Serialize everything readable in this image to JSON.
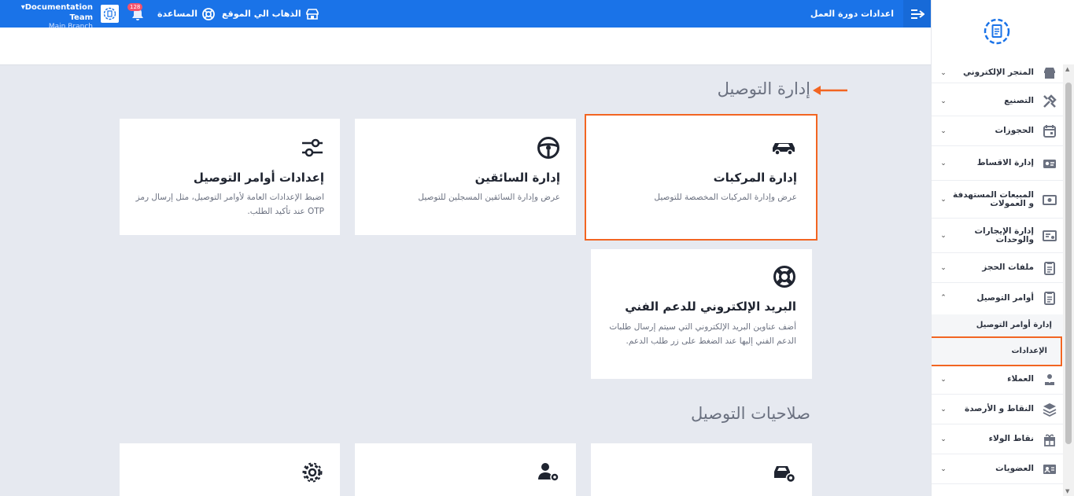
{
  "topbar": {
    "page_title": "اعدادات دورة العمل",
    "goto_site": "الذهاب الي الموقع",
    "help": "المساعدة",
    "notifications_count": "128",
    "user_name": "Documentation Team",
    "user_branch": "Main Branch"
  },
  "sidebar": {
    "items": [
      {
        "label": "المتجر الإلكتروني",
        "icon": "store-icon"
      },
      {
        "label": "التصنيع",
        "icon": "tools-icon"
      },
      {
        "label": "الحجوزات",
        "icon": "calendar-icon"
      },
      {
        "label": "إدارة الاقساط",
        "icon": "installments-icon"
      },
      {
        "label": "المبيعات المستهدفة و العمولات",
        "icon": "money-icon"
      },
      {
        "label": "إدارة الإيجارات والوحدات",
        "icon": "rental-icon"
      },
      {
        "label": "ملفات الحجز",
        "icon": "clipboard-icon"
      },
      {
        "label": "أوامر التوصيل",
        "icon": "clipboard-icon"
      },
      {
        "label": "العملاء",
        "icon": "users-icon"
      },
      {
        "label": "النقاط و الأرصدة",
        "icon": "layers-icon"
      },
      {
        "label": "نقاط الولاء",
        "icon": "gift-icon"
      },
      {
        "label": "العضويات",
        "icon": "membership-icon"
      }
    ],
    "sub_items": [
      "إدارة أوامر التوصيل",
      "الإعدادات"
    ]
  },
  "main": {
    "section1_title": "إدارة التوصيل",
    "section2_title": "صلاحيات التوصيل",
    "cards": [
      {
        "title": "إدارة المركبات",
        "desc": "عرض وإدارة المركبات المخصصة للتوصيل",
        "icon": "car-icon"
      },
      {
        "title": "إدارة السائقين",
        "desc": "عرض وإدارة السائقين المسجلين للتوصيل",
        "icon": "steering-wheel-icon"
      },
      {
        "title": "إعدادات أوامر التوصيل",
        "desc": "اضبط الإعدادات العامة لأوامر التوصيل، مثل إرسال رمز OTP عند تأكيد الطلب.",
        "icon": "sliders-icon"
      },
      {
        "title": "البريد الإلكتروني للدعم الفني",
        "desc": "أضف عناوين البريد الإلكتروني التي سيتم إرسال طلبات الدعم الفني إليها عند الضغط على زر طلب الدعم.",
        "icon": "lifebuoy-icon"
      }
    ]
  },
  "colors": {
    "topbar": "#1a73e8",
    "highlight": "#f26522",
    "background": "#e6e9f0"
  }
}
